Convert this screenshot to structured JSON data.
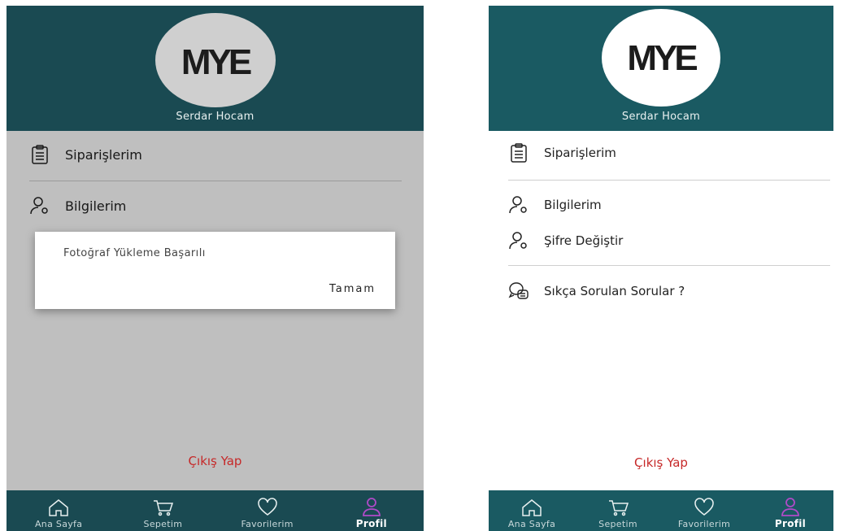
{
  "left": {
    "logo_text": "MYE",
    "user_name": "Serdar Hocam",
    "menu": [
      {
        "label": "Siparişlerim",
        "icon": "clipboard-icon"
      },
      {
        "label": "Bilgilerim",
        "icon": "user-gear-icon"
      }
    ],
    "logout_label": "Çıkış Yap",
    "dialog": {
      "message": "Fotoğraf Yükleme Başarılı",
      "ok_label": "Tamam"
    },
    "nav": [
      {
        "label": "Ana Sayfa",
        "icon": "home-icon"
      },
      {
        "label": "Sepetim",
        "icon": "cart-icon"
      },
      {
        "label": "Favorilerim",
        "icon": "heart-icon"
      },
      {
        "label": "Profil",
        "icon": "profile-icon"
      }
    ]
  },
  "right": {
    "logo_text": "MYE",
    "user_name": "Serdar Hocam",
    "menu": [
      {
        "label": "Siparişlerim",
        "icon": "clipboard-icon"
      },
      {
        "label": "Bilgilerim",
        "icon": "user-gear-icon"
      },
      {
        "label": "Şifre Değiştir",
        "icon": "user-gear-icon"
      },
      {
        "label": "Sıkça Sorulan Sorular ?",
        "icon": "faq-chat-icon"
      }
    ],
    "logout_label": "Çıkış Yap",
    "nav": [
      {
        "label": "Ana Sayfa",
        "icon": "home-icon"
      },
      {
        "label": "Sepetim",
        "icon": "cart-icon"
      },
      {
        "label": "Favorilerim",
        "icon": "heart-icon"
      },
      {
        "label": "Profil",
        "icon": "profile-icon"
      }
    ]
  },
  "colors": {
    "header": "#1a5a62",
    "logout": "#c62828",
    "active_nav": "#b04ac8"
  }
}
